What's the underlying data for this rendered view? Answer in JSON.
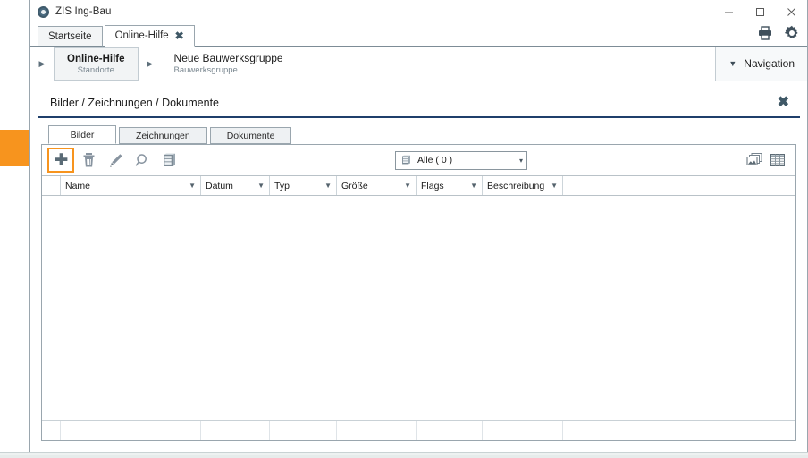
{
  "window": {
    "title": "ZIS Ing-Bau",
    "app_icon": "circle-target-icon",
    "controls": {
      "minimize": "minimize-icon",
      "maximize": "maximize-icon",
      "close": "close-icon"
    }
  },
  "tabs": [
    {
      "label": "Startseite",
      "active": false,
      "closable": false
    },
    {
      "label": "Online-Hilfe",
      "active": true,
      "closable": true,
      "close_glyph": "✖"
    }
  ],
  "header_tools": [
    {
      "name": "print-icon"
    },
    {
      "name": "settings-gear-icon"
    }
  ],
  "breadcrumb": {
    "arrow_glyph": "▶",
    "items": [
      {
        "title": "Online-Hilfe",
        "subtitle": "Standorte",
        "boxed": true
      },
      {
        "title": "Neue Bauwerksgruppe",
        "subtitle": "Bauwerksgruppe",
        "boxed": false
      }
    ],
    "navigation_button": {
      "label": "Navigation",
      "caret": "▼"
    }
  },
  "panel": {
    "title": "Bilder / Zeichnungen / Dokumente",
    "close_glyph": "✖",
    "accent_color": "#1f3f6b"
  },
  "inner_tabs": [
    {
      "label": "Bilder",
      "active": true
    },
    {
      "label": "Zeichnungen",
      "active": false
    },
    {
      "label": "Dokumente",
      "active": false
    }
  ],
  "toolbar": {
    "buttons": [
      {
        "name": "add-icon",
        "label": "Hinzufügen",
        "highlighted": true
      },
      {
        "name": "delete-trash-icon",
        "label": "Löschen",
        "highlighted": false
      },
      {
        "name": "edit-pencil-icon",
        "label": "Bearbeiten",
        "highlighted": false
      },
      {
        "name": "search-magnifier-icon",
        "label": "Suchen",
        "highlighted": false
      },
      {
        "name": "archive-cabinet-icon",
        "label": "Archiv",
        "highlighted": false
      }
    ],
    "highlight_color": "#f7941e",
    "filter": {
      "icon": "archive-cabinet-icon",
      "value": "Alle ( 0 )",
      "caret": "▾"
    },
    "view_toggles": [
      {
        "name": "thumbnail-view-icon",
        "label": "Vorschau"
      },
      {
        "name": "table-view-icon",
        "label": "Tabelle"
      }
    ]
  },
  "grid": {
    "filter_glyph": "▼",
    "columns": [
      {
        "label": "Name",
        "width": 157
      },
      {
        "label": "Datum",
        "width": 77
      },
      {
        "label": "Typ",
        "width": 75
      },
      {
        "label": "Größe",
        "width": 89
      },
      {
        "label": "Flags",
        "width": 74
      },
      {
        "label": "Beschreibung",
        "width": 90
      }
    ],
    "rows": []
  },
  "annotation": {
    "orange_marker_color": "#f7941e"
  }
}
